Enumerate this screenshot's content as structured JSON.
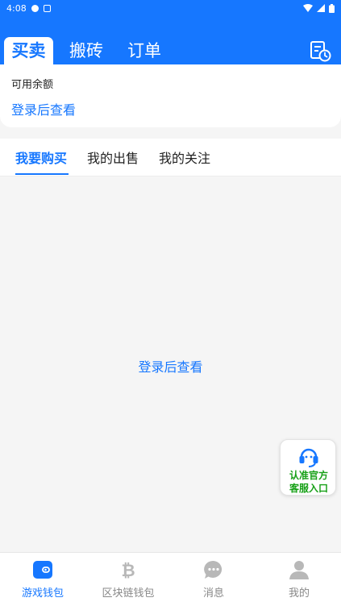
{
  "status_bar": {
    "time": "4:08"
  },
  "header": {
    "tabs": [
      {
        "label": "买卖"
      },
      {
        "label": "搬砖"
      },
      {
        "label": "订单"
      }
    ]
  },
  "balance": {
    "label": "可用余额",
    "login_link": "登录后查看"
  },
  "sub_tabs": [
    {
      "label": "我要购买"
    },
    {
      "label": "我的出售"
    },
    {
      "label": "我的关注"
    }
  ],
  "content": {
    "login_prompt": "登录后查看"
  },
  "service": {
    "line1": "认准官方",
    "line2": "客服入口"
  },
  "bottom_nav": [
    {
      "label": "游戏钱包",
      "icon": "wallet-icon"
    },
    {
      "label": "区块链钱包",
      "icon": "bitcoin-icon"
    },
    {
      "label": "消息",
      "icon": "message-icon"
    },
    {
      "label": "我的",
      "icon": "profile-icon"
    }
  ],
  "colors": {
    "primary": "#1677ff",
    "service_green": "#17a017",
    "inactive": "#888888"
  }
}
